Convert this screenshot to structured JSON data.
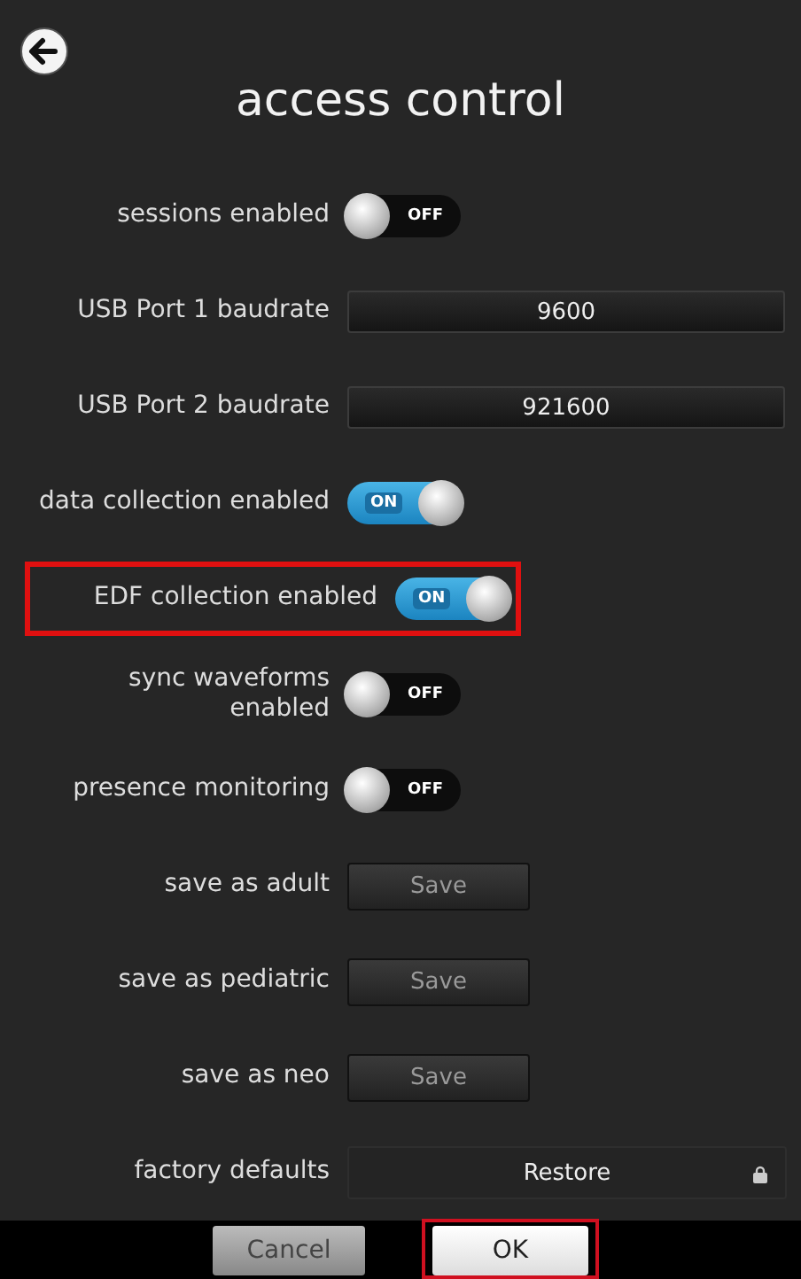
{
  "header": {
    "title": "access control"
  },
  "settings": [
    {
      "kind": "toggle",
      "label": "sessions enabled",
      "on": false,
      "state_text": "OFF",
      "highlighted": false
    },
    {
      "kind": "select",
      "label": "USB Port 1 baudrate",
      "value": "9600",
      "highlighted": false
    },
    {
      "kind": "select",
      "label": "USB Port 2 baudrate",
      "value": "921600",
      "highlighted": false
    },
    {
      "kind": "toggle",
      "label": "data collection enabled",
      "on": true,
      "state_text": "ON",
      "highlighted": false
    },
    {
      "kind": "toggle",
      "label": "EDF collection enabled",
      "on": true,
      "state_text": "ON",
      "highlighted": true
    },
    {
      "kind": "toggle",
      "label": "sync waveforms enabled",
      "on": false,
      "state_text": "OFF",
      "highlighted": false
    },
    {
      "kind": "toggle",
      "label": "presence monitoring",
      "on": false,
      "state_text": "OFF",
      "highlighted": false
    },
    {
      "kind": "button",
      "label": "save as adult",
      "button": "Save",
      "highlighted": false
    },
    {
      "kind": "button",
      "label": "save as pediatric",
      "button": "Save",
      "highlighted": false
    },
    {
      "kind": "button",
      "label": "save as neo",
      "button": "Save",
      "highlighted": false
    },
    {
      "kind": "locked_button",
      "label": "factory defaults",
      "button": "Restore",
      "highlighted": false
    }
  ],
  "footer": {
    "buttons": [
      {
        "label": "Cancel",
        "highlighted": false
      },
      {
        "label": "OK",
        "highlighted": true
      }
    ]
  }
}
